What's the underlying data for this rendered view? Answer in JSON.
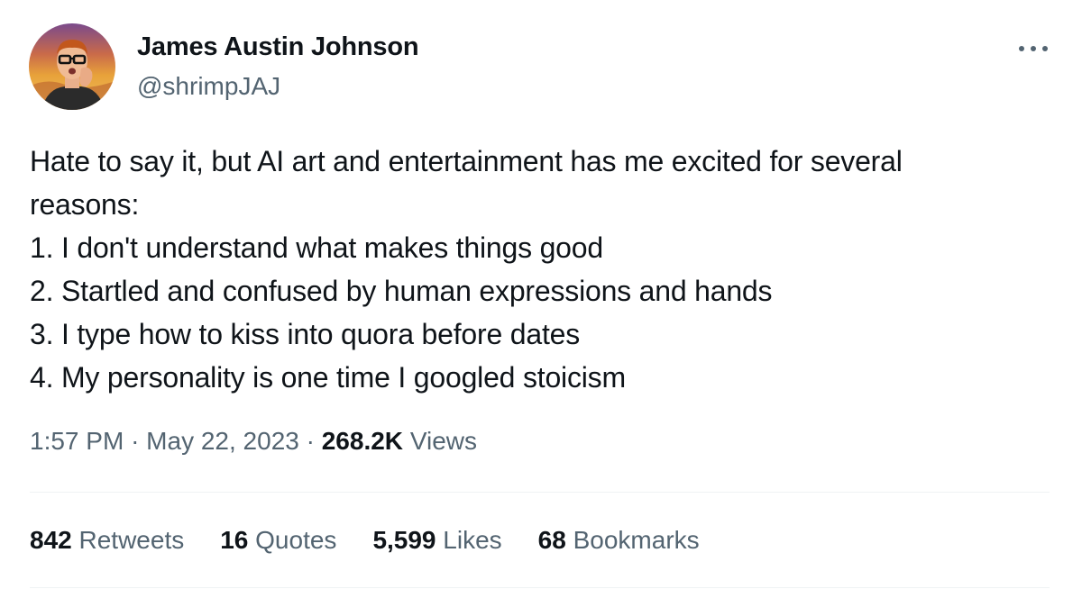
{
  "author": {
    "name": "James Austin Johnson",
    "handle": "@shrimpJAJ",
    "avatar_icon": "user-avatar"
  },
  "tweet": {
    "lines": [
      "Hate to say it, but AI art and entertainment has me excited for several",
      "reasons:",
      "1. I don't understand what makes things good",
      "2. Startled and confused by human expressions and hands",
      "3. I type how to kiss into quora before dates",
      "4. My personality is one time I googled stoicism"
    ]
  },
  "meta": {
    "time": "1:57 PM",
    "separator": "·",
    "date": "May 22, 2023",
    "views_count": "268.2K",
    "views_label": "Views"
  },
  "stats": {
    "retweets_count": "842",
    "retweets_label": "Retweets",
    "quotes_count": "16",
    "quotes_label": "Quotes",
    "likes_count": "5,599",
    "likes_label": "Likes",
    "bookmarks_count": "68",
    "bookmarks_label": "Bookmarks"
  },
  "colors": {
    "text_primary": "#0f1419",
    "text_secondary": "#536471",
    "divider": "#eff3f4"
  },
  "icons": {
    "more": "more-icon"
  }
}
